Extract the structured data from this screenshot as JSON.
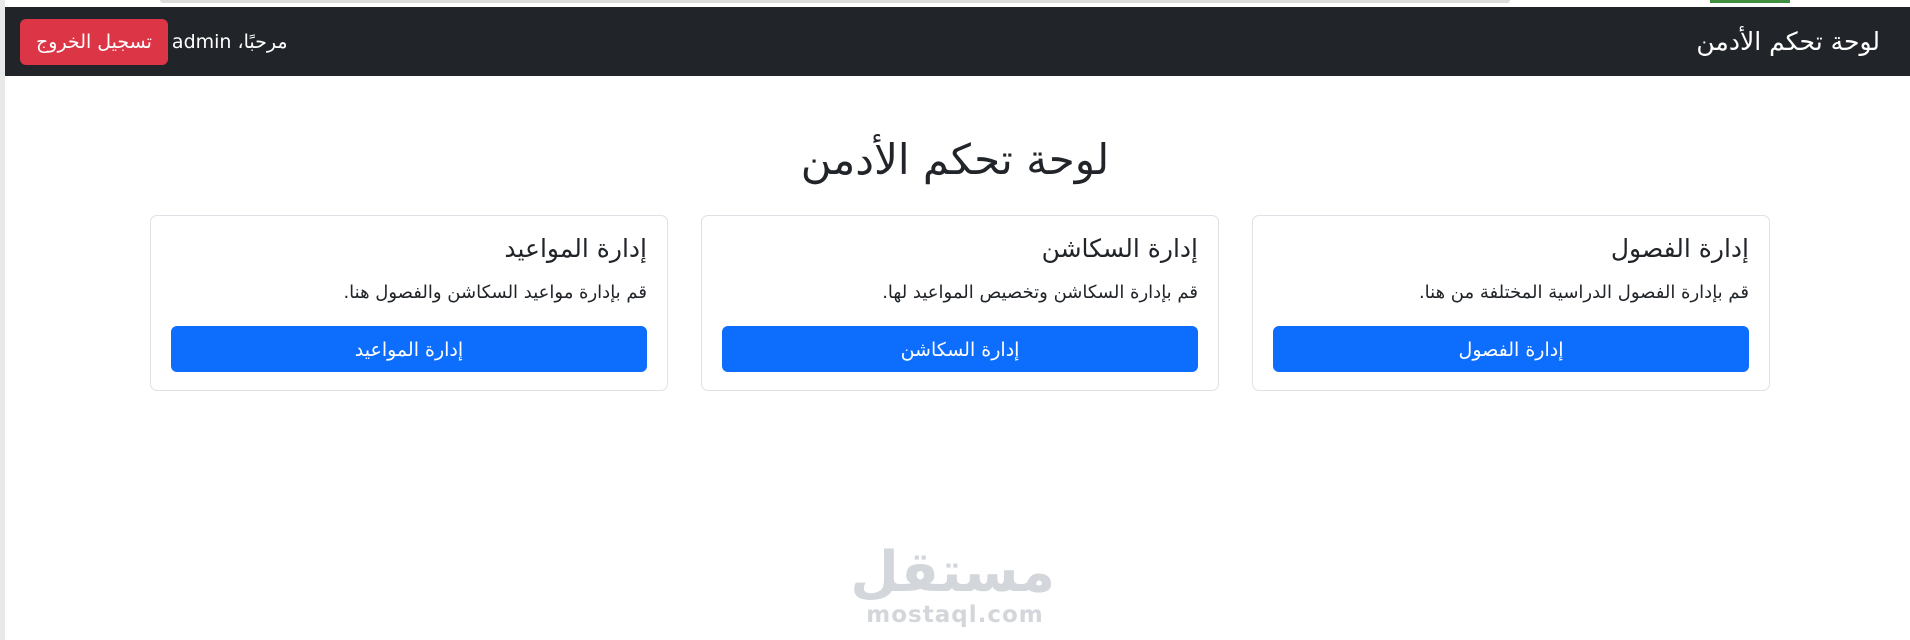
{
  "navbar": {
    "brand": "لوحة تحكم الأدمن",
    "welcome": "مرحبًا، admin",
    "logout_label": "تسجيل الخروج"
  },
  "main": {
    "title": "لوحة تحكم الأدمن",
    "cards": [
      {
        "title": "إدارة الفصول",
        "text": "قم بإدارة الفصول الدراسية المختلفة من هنا.",
        "button": "إدارة الفصول"
      },
      {
        "title": "إدارة السكاشن",
        "text": "قم بإدارة السكاشن وتخصيص المواعيد لها.",
        "button": "إدارة السكاشن"
      },
      {
        "title": "إدارة المواعيد",
        "text": "قم بإدارة مواعيد السكاشن والفصول هنا.",
        "button": "إدارة المواعيد"
      }
    ]
  },
  "watermark": {
    "arabic": "مستقل",
    "latin": "mostaql.com"
  },
  "colors": {
    "navbar_bg": "#212529",
    "danger": "#dc3545",
    "primary": "#0d6efd"
  }
}
